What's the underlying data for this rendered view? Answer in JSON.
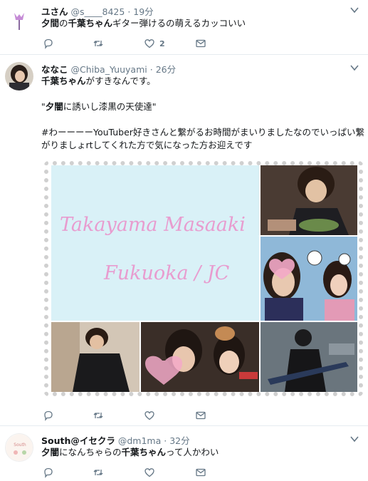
{
  "tweets": [
    {
      "name": "ユさん",
      "handle": "@s____8425",
      "time": "19分",
      "text_parts": [
        "夕間",
        "の",
        "千葉ちゃん",
        "ギター弾けるの萌えるカッコいい"
      ],
      "actions": {
        "reply": "",
        "retweet": "",
        "like": "2",
        "dm": ""
      }
    },
    {
      "name": "ななこ",
      "handle": "@Chiba_Yuuyami",
      "time": "26分",
      "line1_parts": [
        "千葉ちゃん",
        "がすきなんです。"
      ],
      "line2_parts": [
        "\"",
        "夕闇",
        "に誘いし漆黒の天使達\""
      ],
      "line3": "#わーーーーYouTuber好きさんと繋がるお時間がまいりましたなのでいっぱい繋",
      "line4": "がりましょrtしてくれた方で気になった方お迎えです",
      "image_text": {
        "line1": "Takayama Masaaki",
        "line2": "Fukuoka / JC"
      },
      "actions": {
        "reply": "",
        "retweet": "",
        "like": "",
        "dm": ""
      }
    },
    {
      "name": "South@イセクラ",
      "handle": "@dm1ma",
      "time": "32分",
      "text_parts": [
        "夕闇",
        "になんちゃらの",
        "千葉ちゃん",
        "って人かわい"
      ],
      "actions": {
        "reply": "",
        "retweet": "",
        "like": "",
        "dm": ""
      }
    }
  ],
  "colors": {
    "text": "#14171a",
    "meta": "#657786",
    "border": "#e6ecf0",
    "pink": "#e89ccf",
    "lightblue": "#d9f1f7"
  },
  "icons": [
    "reply-icon",
    "retweet-icon",
    "like-icon",
    "dm-icon",
    "caret-down-icon"
  ]
}
